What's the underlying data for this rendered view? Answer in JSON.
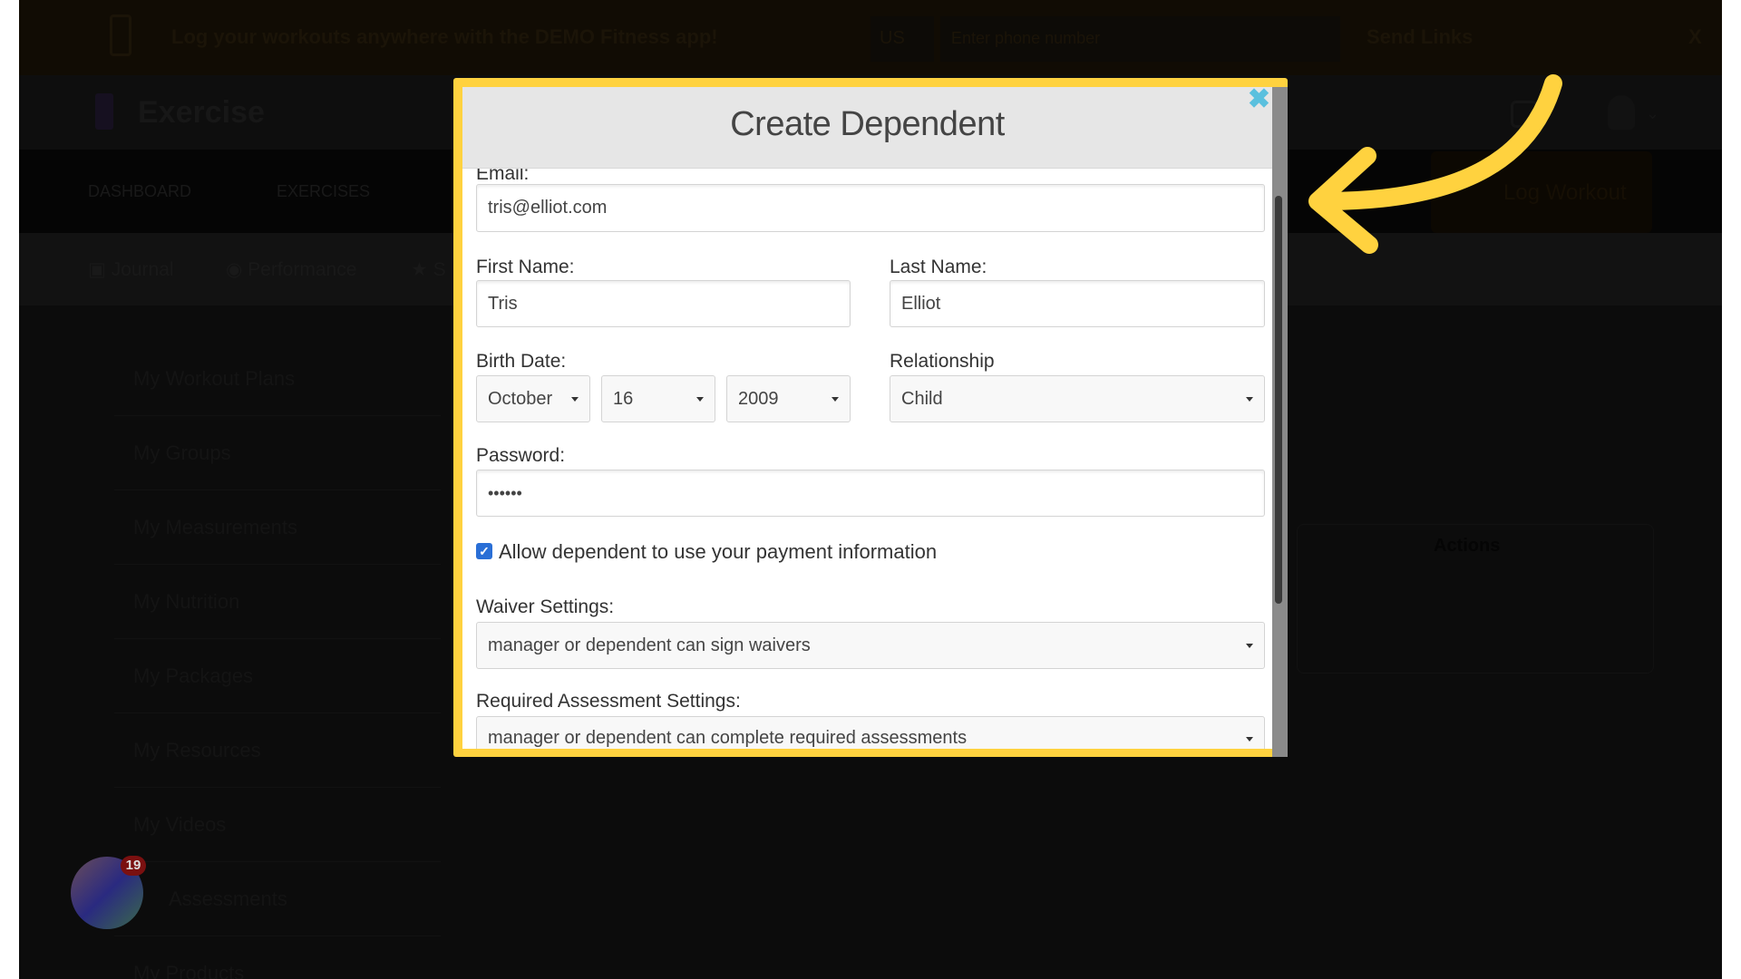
{
  "banner": {
    "text": "Log your workouts anywhere with the DEMO Fitness app!",
    "country": "US",
    "phone_placeholder": "Enter phone number",
    "send_label": "Send Links",
    "close_label": "X"
  },
  "header": {
    "app_title": "Exercise"
  },
  "nav": {
    "items": [
      "DASHBOARD",
      "EXERCISES"
    ],
    "log_workout": "Log Workout"
  },
  "subnav": {
    "items": [
      "Journal",
      "Performance",
      "S"
    ]
  },
  "sidebar": {
    "items": [
      "My Workout Plans",
      "My Groups",
      "My Measurements",
      "My Nutrition",
      "My Packages",
      "My Resources",
      "My Videos",
      "Assessments",
      "My Products"
    ]
  },
  "card": {
    "actions_header": "Actions"
  },
  "chat": {
    "badge": "19"
  },
  "modal": {
    "title": "Create Dependent",
    "email_label": "Email:",
    "email_value": "tris@elliot.com",
    "first_label": "First Name:",
    "first_value": "Tris",
    "last_label": "Last Name:",
    "last_value": "Elliot",
    "birth_label": "Birth Date:",
    "birth_month": "October",
    "birth_day": "16",
    "birth_year": "2009",
    "relationship_label": "Relationship",
    "relationship_value": "Child",
    "password_label": "Password:",
    "password_value": "••••••",
    "payment_checkbox_label": "Allow dependent to use your payment information",
    "payment_checked": true,
    "waiver_label": "Waiver Settings:",
    "waiver_value": "manager or dependent can sign waivers",
    "assessment_label": "Required Assessment Settings:",
    "assessment_value": "manager or dependent can complete required assessments"
  },
  "colors": {
    "highlight": "#ffd23f",
    "close": "#5bc0de",
    "checkbox": "#2a6fd6"
  }
}
